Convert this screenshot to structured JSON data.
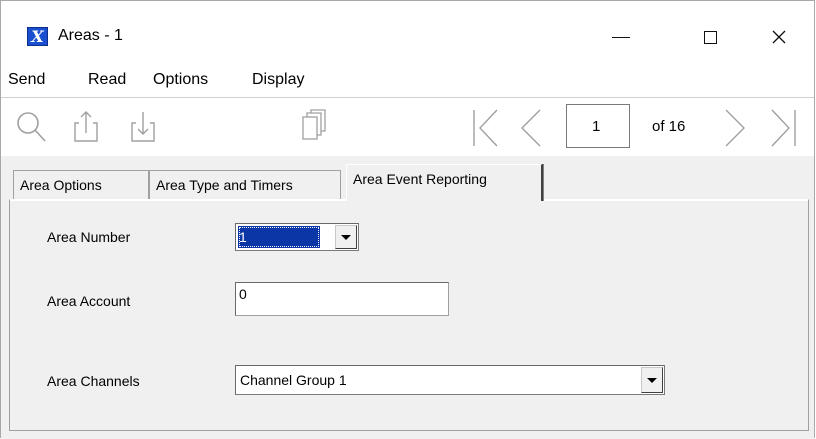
{
  "window": {
    "title": "Areas - 1",
    "icon": "app-x-icon"
  },
  "menu": [
    "Send",
    "Read",
    "Options",
    "Display"
  ],
  "toolbar": {
    "icons": [
      "search-icon",
      "upload-icon",
      "download-icon",
      "copy-icon",
      "first-page-icon",
      "previous-page-icon",
      "next-page-icon",
      "last-page-icon"
    ],
    "page_value": "1",
    "page_of": "of 16"
  },
  "tabs": [
    {
      "label": "Area Options",
      "active": false
    },
    {
      "label": "Area Type and Timers",
      "active": false
    },
    {
      "label": "Area Event Reporting",
      "active": true
    }
  ],
  "form": {
    "area_number_label": "Area Number",
    "area_number_value": "1",
    "area_account_label": "Area Account",
    "area_account_value": "0",
    "area_channels_label": "Area Channels",
    "area_channels_value": "Channel Group 1"
  },
  "colors": {
    "accent_selection": "#0a36a6",
    "panel_bg": "#f0f0f0",
    "icon_gray": "#a0a0a0"
  }
}
